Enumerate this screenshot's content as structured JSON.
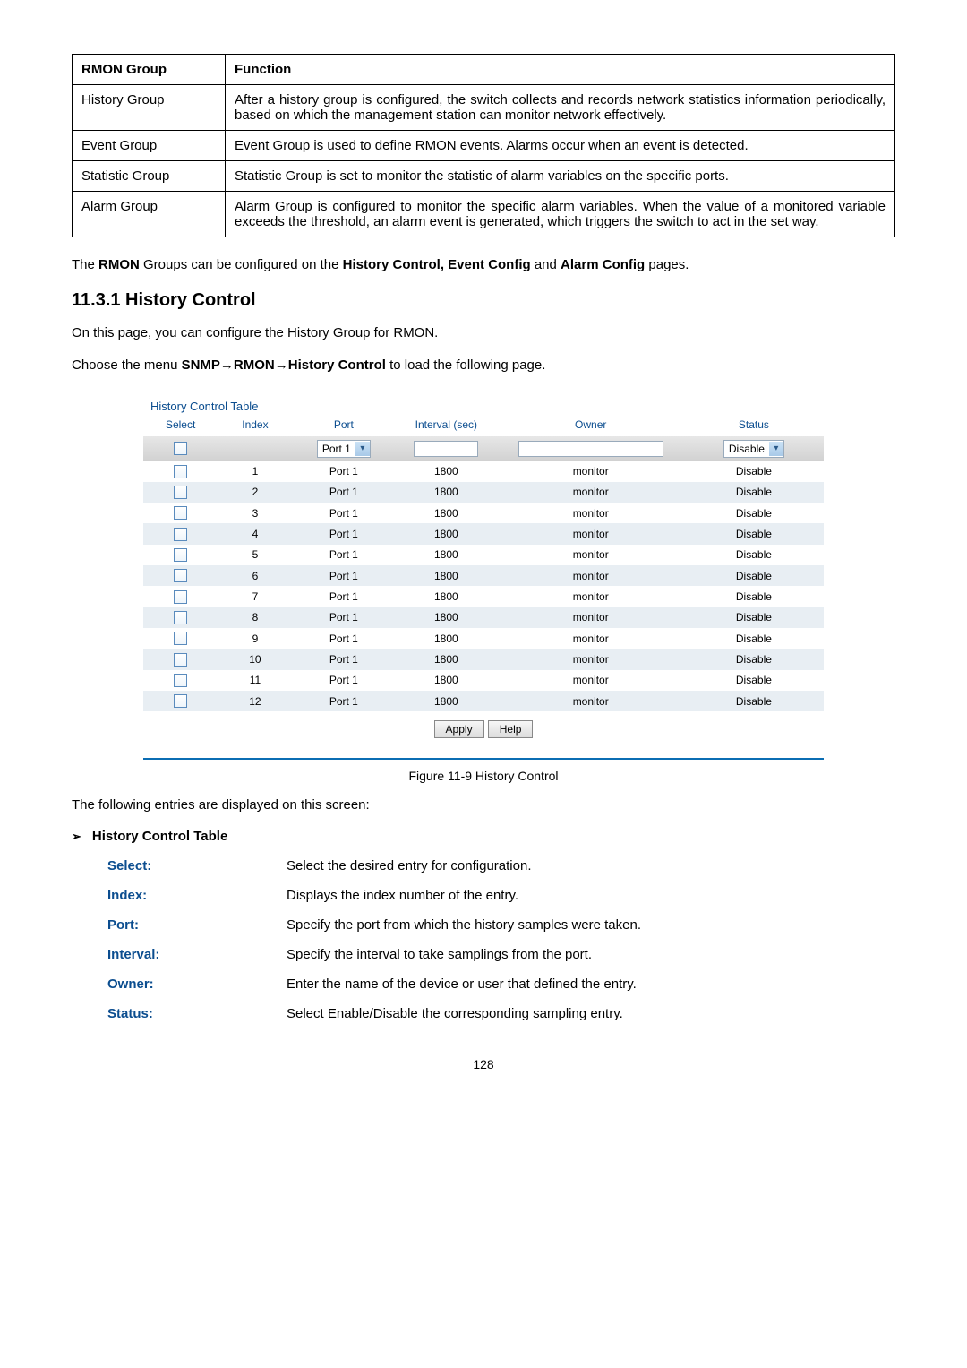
{
  "rmon_table": {
    "headers": [
      "RMON Group",
      "Function"
    ],
    "rows": [
      {
        "group": "History Group",
        "func": "After a history group is configured, the switch collects and records network statistics information periodically, based on which the management station can monitor network effectively."
      },
      {
        "group": "Event Group",
        "func": "Event Group is used to define RMON events. Alarms occur when an event is detected."
      },
      {
        "group": "Statistic Group",
        "func": "Statistic Group is set to monitor the statistic of alarm variables on the specific ports."
      },
      {
        "group": "Alarm Group",
        "func": "Alarm Group is configured to monitor the specific alarm variables. When the value of a monitored variable exceeds the threshold, an alarm event is generated, which triggers the switch to act in the set way."
      }
    ]
  },
  "intro_para_pre": "The ",
  "intro_para_b1": "RMON",
  "intro_para_mid1": " Groups can be configured on the ",
  "intro_para_b2": "History Control, Event Config",
  "intro_para_mid2": " and ",
  "intro_para_b3": "Alarm Config",
  "intro_para_post": " pages.",
  "section_heading": "11.3.1 History Control",
  "section_p1": "On this page, you can configure the History Group for RMON.",
  "menu_pre": "Choose the menu ",
  "menu_bold": "SNMP→RMON→History Control",
  "menu_post": " to load the following page.",
  "figure": {
    "title": "History Control Table",
    "columns": [
      "Select",
      "Index",
      "Port",
      "Interval (sec)",
      "Owner",
      "Status"
    ],
    "filter_port": "Port 1",
    "filter_status": "Disable",
    "rows": [
      {
        "idx": "1",
        "port": "Port 1",
        "interval": "1800",
        "owner": "monitor",
        "status": "Disable"
      },
      {
        "idx": "2",
        "port": "Port 1",
        "interval": "1800",
        "owner": "monitor",
        "status": "Disable"
      },
      {
        "idx": "3",
        "port": "Port 1",
        "interval": "1800",
        "owner": "monitor",
        "status": "Disable"
      },
      {
        "idx": "4",
        "port": "Port 1",
        "interval": "1800",
        "owner": "monitor",
        "status": "Disable"
      },
      {
        "idx": "5",
        "port": "Port 1",
        "interval": "1800",
        "owner": "monitor",
        "status": "Disable"
      },
      {
        "idx": "6",
        "port": "Port 1",
        "interval": "1800",
        "owner": "monitor",
        "status": "Disable"
      },
      {
        "idx": "7",
        "port": "Port 1",
        "interval": "1800",
        "owner": "monitor",
        "status": "Disable"
      },
      {
        "idx": "8",
        "port": "Port 1",
        "interval": "1800",
        "owner": "monitor",
        "status": "Disable"
      },
      {
        "idx": "9",
        "port": "Port 1",
        "interval": "1800",
        "owner": "monitor",
        "status": "Disable"
      },
      {
        "idx": "10",
        "port": "Port 1",
        "interval": "1800",
        "owner": "monitor",
        "status": "Disable"
      },
      {
        "idx": "11",
        "port": "Port 1",
        "interval": "1800",
        "owner": "monitor",
        "status": "Disable"
      },
      {
        "idx": "12",
        "port": "Port 1",
        "interval": "1800",
        "owner": "monitor",
        "status": "Disable"
      }
    ],
    "buttons": {
      "apply": "Apply",
      "help": "Help"
    }
  },
  "figure_caption": "Figure 11-9 History Control",
  "entries_intro": "The following entries are displayed on this screen:",
  "bullet_title": "History Control Table",
  "defs": [
    {
      "term": "Select:",
      "desc": "Select the desired entry for configuration."
    },
    {
      "term": "Index:",
      "desc": "Displays the index number of the entry."
    },
    {
      "term": "Port:",
      "desc": "Specify the port from which the history samples were taken."
    },
    {
      "term": "Interval:",
      "desc": "Specify the interval to take samplings from the port."
    },
    {
      "term": "Owner:",
      "desc": "Enter the name of the device or user that defined the entry."
    },
    {
      "term": "Status:",
      "desc": "Select Enable/Disable the corresponding sampling entry."
    }
  ],
  "page_number": "128"
}
